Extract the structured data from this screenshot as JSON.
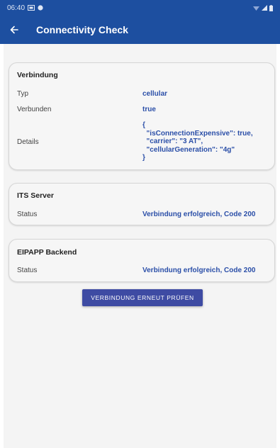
{
  "status_bar": {
    "time": "06:40"
  },
  "app_bar": {
    "title": "Connectivity Check"
  },
  "cards": [
    {
      "title": "Verbindung",
      "rows": [
        {
          "label": "Typ",
          "value": "cellular"
        },
        {
          "label": "Verbunden",
          "value": "true"
        },
        {
          "label": "Details",
          "value": "{\n  \"isConnectionExpensive\": true,\n  \"carrier\": \"3 AT\",\n  \"cellularGeneration\": \"4g\"\n}"
        }
      ]
    },
    {
      "title": "ITS Server",
      "rows": [
        {
          "label": "Status",
          "value": "Verbindung erfolgreich, Code 200"
        }
      ]
    },
    {
      "title": "EIPAPP Backend",
      "rows": [
        {
          "label": "Status",
          "value": "Verbindung erfolgreich, Code 200"
        }
      ]
    }
  ],
  "retry_button": {
    "label": "VERBINDUNG ERNEUT PRÜFEN"
  },
  "colors": {
    "app_bar": "#1d4fa0",
    "value_text": "#2b4fa8",
    "button": "#3e4ba3"
  }
}
